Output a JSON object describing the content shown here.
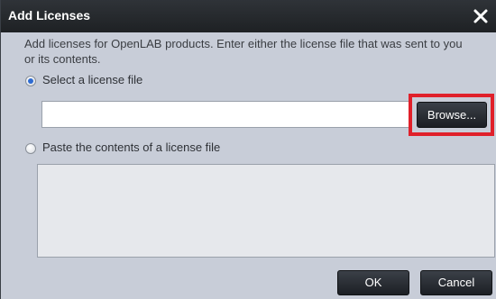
{
  "dialog": {
    "title": "Add Licenses",
    "description": "Add licenses for OpenLAB products. Enter either the license file that was sent to you or its contents."
  },
  "options": {
    "select_file_label": "Select a license file",
    "select_file_checked": true,
    "paste_contents_label": "Paste the contents of a license file",
    "paste_contents_checked": false
  },
  "file_input": {
    "value": "",
    "placeholder": ""
  },
  "paste_area": {
    "value": ""
  },
  "buttons": {
    "browse_label": "Browse...",
    "ok_label": "OK",
    "cancel_label": "Cancel"
  },
  "icons": {
    "close": "close-icon"
  },
  "colors": {
    "titlebar": "#1e2124",
    "dialog_background": "#c8cdd8",
    "highlight_border": "#e0202a",
    "button_dark": "#2a2e34"
  }
}
